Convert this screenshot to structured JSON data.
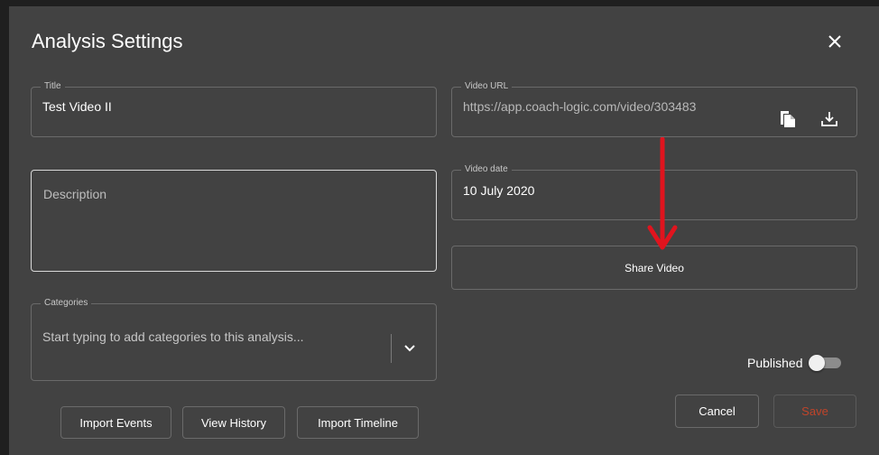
{
  "dialog": {
    "title": "Analysis Settings",
    "close_icon": "close-icon"
  },
  "title_field": {
    "legend": "Title",
    "value": "Test Video II"
  },
  "video_url_field": {
    "legend": "Video URL",
    "value": "https://app.coach-logic.com/video/303483",
    "copy_icon": "copy-icon",
    "download_icon": "download-icon"
  },
  "description_field": {
    "placeholder": "Description"
  },
  "video_date_field": {
    "legend": "Video date",
    "value": "10 July 2020"
  },
  "share_button": {
    "label": "Share Video"
  },
  "categories_field": {
    "legend": "Categories",
    "placeholder": "Start typing to add categories to this analysis...",
    "chevron_icon": "chevron-down-icon"
  },
  "published": {
    "label": "Published",
    "value": false
  },
  "actions": {
    "cancel_label": "Cancel",
    "save_label": "Save"
  },
  "secondary_actions": {
    "import_events_label": "Import Events",
    "view_history_label": "View History",
    "import_timeline_label": "Import Timeline"
  },
  "colors": {
    "dialog_bg": "#424242",
    "arrow": "#e0141e",
    "save_text": "#c0442a"
  }
}
